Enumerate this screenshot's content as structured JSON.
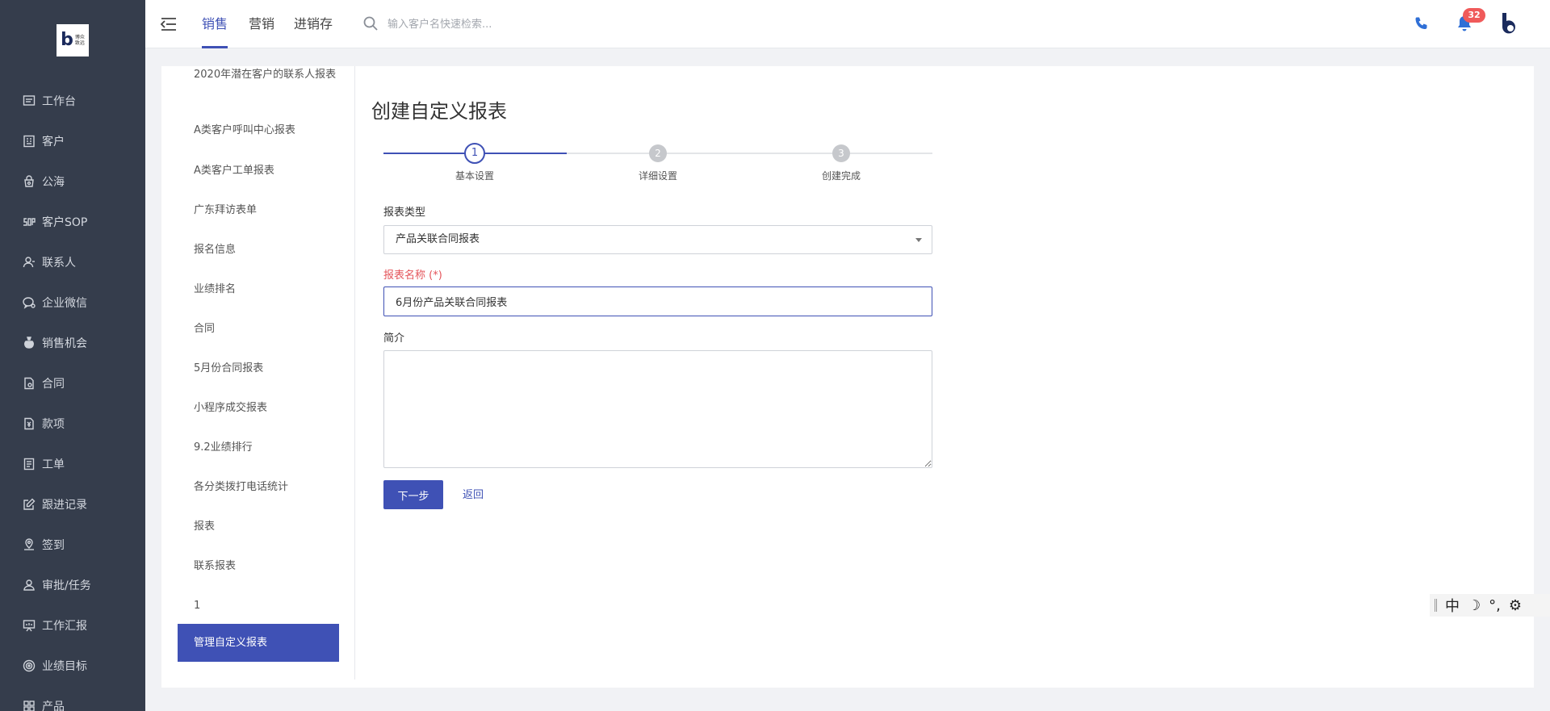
{
  "logo": {
    "text_line1": "博众",
    "text_line2": "致远"
  },
  "sidebar": {
    "items": [
      {
        "label": "工作台",
        "icon": "dashboard-icon"
      },
      {
        "label": "客户",
        "icon": "building-icon"
      },
      {
        "label": "公海",
        "icon": "pool-icon"
      },
      {
        "label": "客户SOP",
        "icon": "sop-icon"
      },
      {
        "label": "联系人",
        "icon": "contact-icon"
      },
      {
        "label": "企业微信",
        "icon": "wechat-icon"
      },
      {
        "label": "销售机会",
        "icon": "money-bag-icon"
      },
      {
        "label": "合同",
        "icon": "contract-icon"
      },
      {
        "label": "款项",
        "icon": "payment-icon"
      },
      {
        "label": "工单",
        "icon": "ticket-icon"
      },
      {
        "label": "跟进记录",
        "icon": "edit-icon"
      },
      {
        "label": "签到",
        "icon": "location-icon"
      },
      {
        "label": "审批/任务",
        "icon": "approval-icon"
      },
      {
        "label": "工作汇报",
        "icon": "report-icon"
      },
      {
        "label": "业绩目标",
        "icon": "target-icon"
      },
      {
        "label": "产品",
        "icon": "product-icon"
      }
    ]
  },
  "topbar": {
    "tabs": [
      {
        "label": "销售",
        "active": true
      },
      {
        "label": "营销",
        "active": false
      },
      {
        "label": "进销存",
        "active": false
      }
    ],
    "search_placeholder": "输入客户名快速检索...",
    "notification_count": "32"
  },
  "report_list": {
    "items": [
      "2020年潜在客户的联系人报表",
      "A类客户呼叫中心报表",
      "A类客户工单报表",
      "广东拜访表单",
      "报名信息",
      "业绩排名",
      "合同",
      "5月份合同报表",
      "小程序成交报表",
      "9.2业绩排行",
      "各分类拨打电话统计",
      "报表",
      "联系报表",
      "1"
    ],
    "active_item": "管理自定义报表"
  },
  "form": {
    "title": "创建自定义报表",
    "steps": [
      {
        "number": "1",
        "label": "基本设置",
        "state": "current"
      },
      {
        "number": "2",
        "label": "详细设置",
        "state": "todo"
      },
      {
        "number": "3",
        "label": "创建完成",
        "state": "todo"
      }
    ],
    "type_label": "报表类型",
    "type_value": "产品关联合同报表",
    "name_label": "报表名称 (*)",
    "name_value": "6月份产品关联合同报表",
    "intro_label": "简介",
    "intro_value": "",
    "next_button": "下一步",
    "back_link": "返回"
  },
  "ime": {
    "mode": "中",
    "moon": "☽",
    "punct": "°,",
    "settings": "⚙"
  },
  "colors": {
    "primary": "#3f51b5",
    "sidebar_bg": "#353d4c",
    "badge": "#f05a5a",
    "required": "#e4545a"
  }
}
